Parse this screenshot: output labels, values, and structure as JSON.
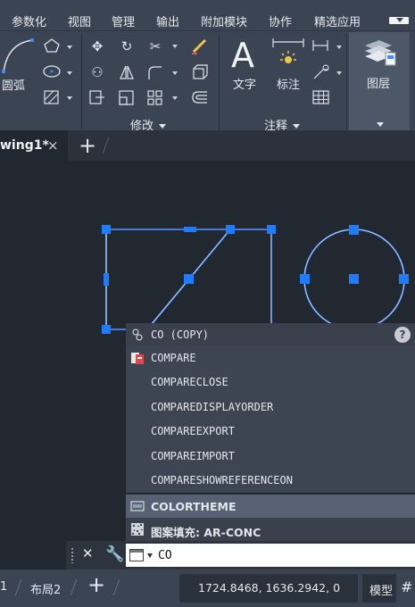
{
  "menu": {
    "items": [
      "参数化",
      "视图",
      "管理",
      "输出",
      "附加模块",
      "协作",
      "精选应用"
    ]
  },
  "ribbon": {
    "arc_label": "圆弧",
    "modify_panel_title": "修改",
    "text_label": "文字",
    "dimension_label": "标注",
    "annotation_panel_title": "注释",
    "layers_label": "图层"
  },
  "tabs": {
    "doc_tab": "wing1*",
    "close_glyph": "×",
    "add_glyph": "+"
  },
  "autocomplete": {
    "top": "CO (COPY)",
    "help": "?",
    "items": [
      "COMPARE",
      "COMPARECLOSE",
      "COMPAREDISPLAYORDER",
      "COMPAREEXPORT",
      "COMPAREIMPORT",
      "COMPARESHOWREFERENCEON"
    ],
    "colortheme": "COLORTHEME",
    "hatch": "图案填充: AR-CONC"
  },
  "command_line": {
    "value": "CO"
  },
  "status": {
    "layout_tab_partial": "1",
    "layout2": "布局2",
    "coords": "1724.8468, 1636.2942, 0",
    "model": "模型"
  },
  "colors": {
    "background": "#212830",
    "panel": "#3b4453",
    "geometry": "#4f8fff",
    "grip": "#1f7cff",
    "popup": "#3c4452",
    "popup_highlight": "#5a6577"
  }
}
